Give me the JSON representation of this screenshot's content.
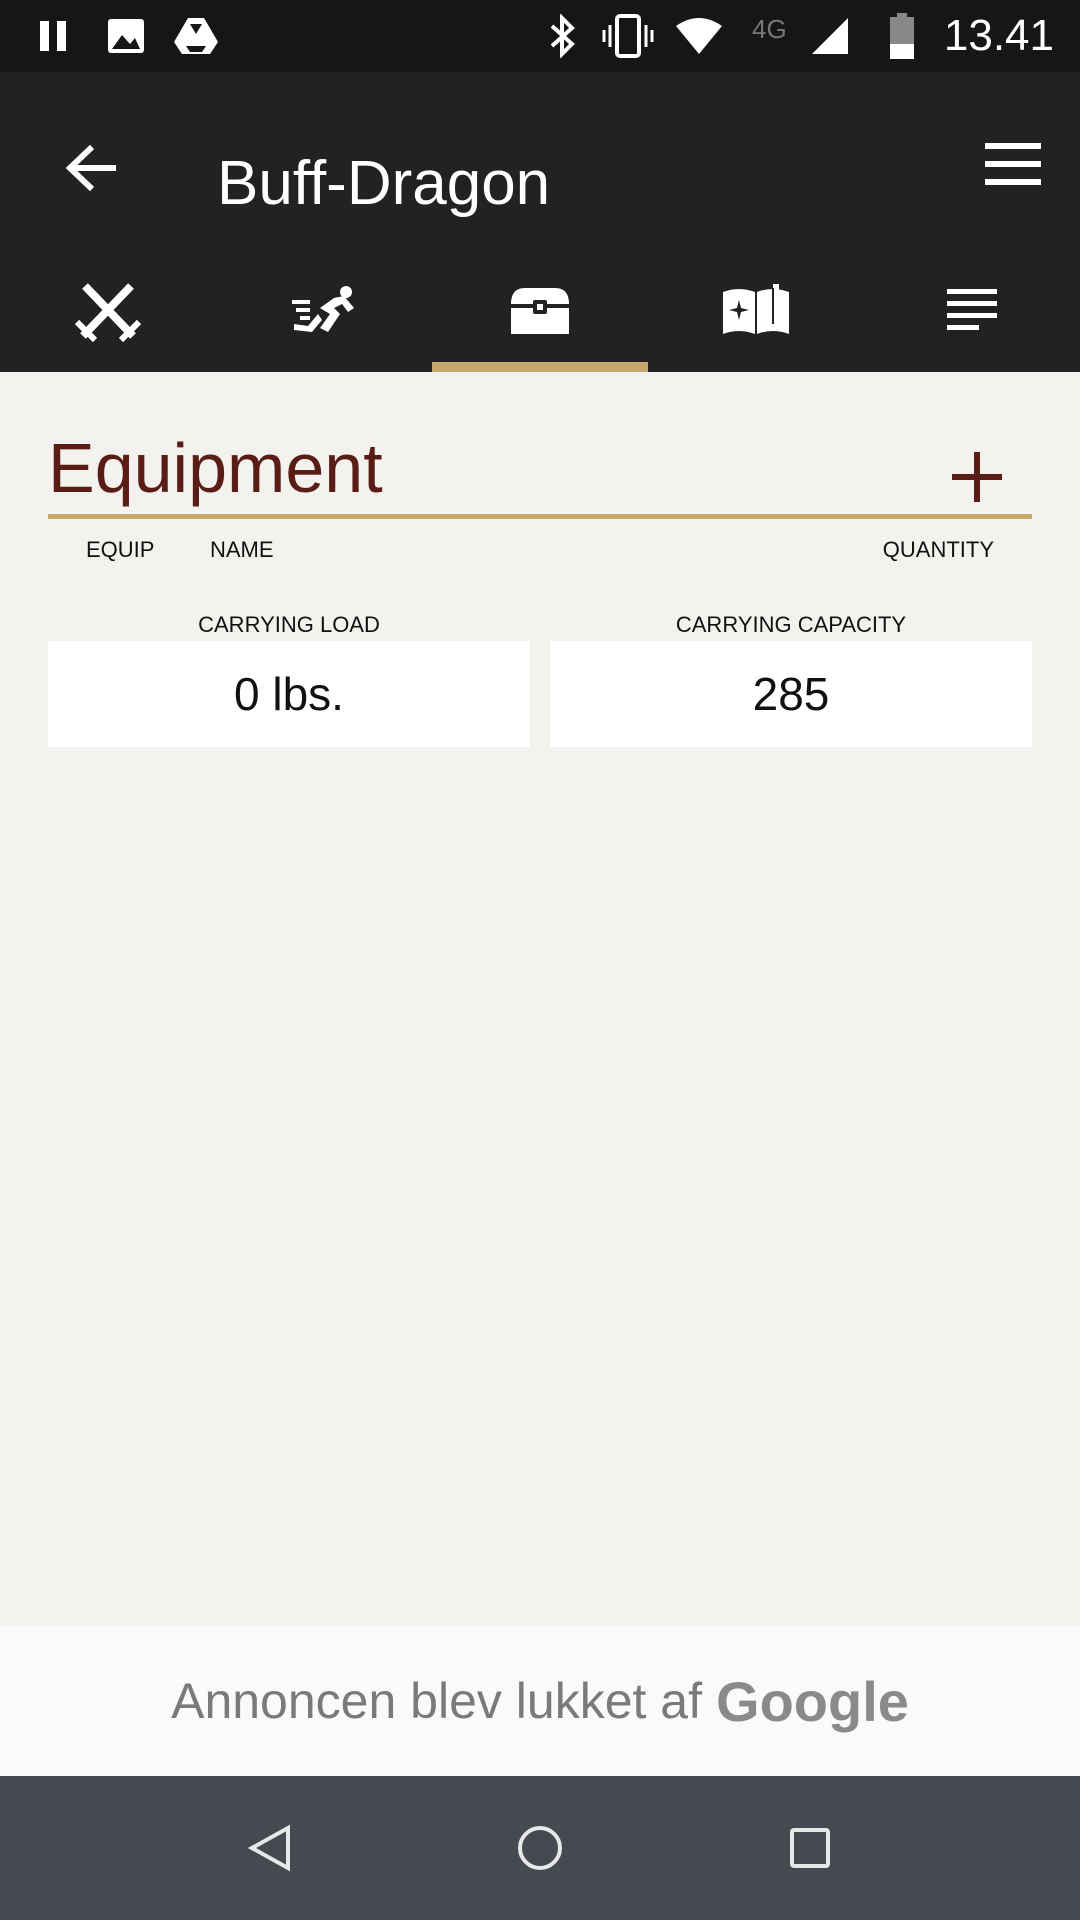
{
  "status_bar": {
    "time": "13.41",
    "icons": [
      "pause-icon",
      "image-icon",
      "drive-icon",
      "bluetooth-icon",
      "vibrate-icon",
      "wifi-icon",
      "network-4g-icon",
      "signal-icon",
      "battery-icon"
    ],
    "network_label": "4G"
  },
  "app_bar": {
    "title": "Buff-Dragon",
    "back_icon": "arrow-back-icon",
    "menu_icon": "hamburger-menu-icon"
  },
  "tabs": [
    {
      "icon": "crossed-swords-icon",
      "selected": false
    },
    {
      "icon": "running-person-icon",
      "selected": false
    },
    {
      "icon": "treasure-chest-icon",
      "selected": true
    },
    {
      "icon": "spellbook-icon",
      "selected": false
    },
    {
      "icon": "notes-icon",
      "selected": false
    }
  ],
  "equipment": {
    "title": "Equipment",
    "add_icon": "plus-icon",
    "columns": {
      "equip": "EQUIP",
      "name": "NAME",
      "quantity": "QUANTITY"
    }
  },
  "carrying": {
    "load_label": "CARRYING LOAD",
    "load_value": "0 lbs.",
    "capacity_label": "CARRYING CAPACITY",
    "capacity_value": "285"
  },
  "ad_banner": {
    "text": "Annoncen blev lukket af",
    "brand": "Google"
  },
  "nav_bar": {
    "icons": [
      "back-triangle-icon",
      "home-circle-icon",
      "recents-square-icon"
    ]
  },
  "colors": {
    "accent": "#c8a86a",
    "title_brown": "#5a1d16",
    "app_bar": "#222223",
    "background": "#f3f2ee"
  }
}
